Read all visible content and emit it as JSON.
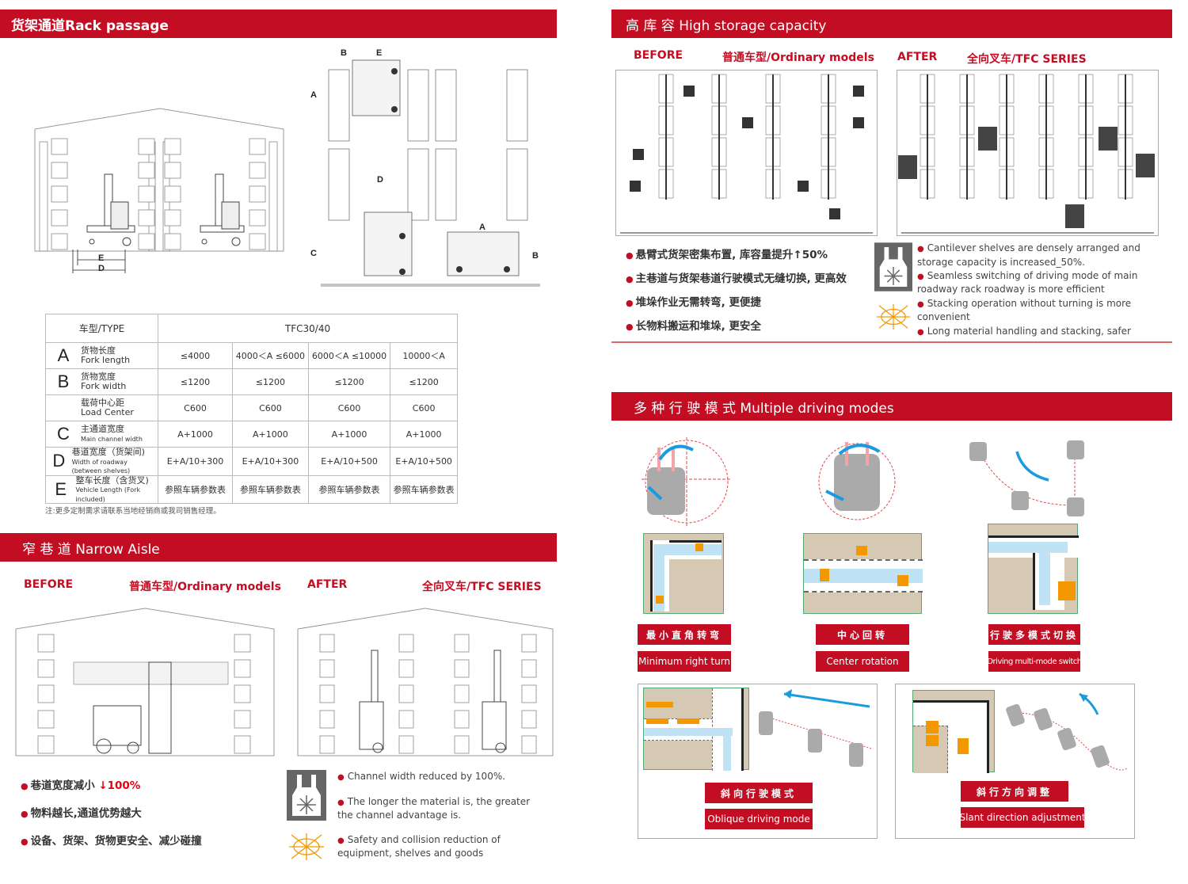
{
  "sections": {
    "rack_passage": {
      "title": "货架通道Rack passage"
    },
    "narrow_aisle": {
      "title": "窄 巷 道 Narrow Aisle"
    },
    "high_storage": {
      "title": "高 库 容 High storage capacity"
    },
    "driving_modes": {
      "title": "多 种 行 驶 模 式  Multiple driving modes"
    }
  },
  "diagram_labels": {
    "side_view": [
      "E",
      "D"
    ],
    "top_view": [
      "B",
      "E",
      "A",
      "D",
      "C",
      "A",
      "B"
    ]
  },
  "spec_table": {
    "type_label": "车型/TYPE",
    "model": "TFC30/40",
    "rows": [
      {
        "letter": "A",
        "cn": "货物长度",
        "en": "Fork length",
        "values": [
          "≤4000",
          "4000＜A ≤6000",
          "6000＜A ≤10000",
          "10000＜A"
        ]
      },
      {
        "letter": "B",
        "cn": "货物宽度",
        "en": "Fork width",
        "values": [
          "≤1200",
          "≤1200",
          "≤1200",
          "≤1200"
        ]
      },
      {
        "letter": "",
        "cn": "载荷中心距",
        "en": "Load Center",
        "values": [
          "C600",
          "C600",
          "C600",
          "C600"
        ]
      },
      {
        "letter": "C",
        "cn": "主通道宽度",
        "en": "Main channel width",
        "values": [
          "A+1000",
          "A+1000",
          "A+1000",
          "A+1000"
        ]
      },
      {
        "letter": "D",
        "cn": "巷道宽度（货架间)",
        "en": "Width of roadway (between shelves)",
        "values": [
          "E+A/10+300",
          "E+A/10+300",
          "E+A/10+500",
          "E+A/10+500"
        ]
      },
      {
        "letter": "E",
        "cn": "整车长度（含货叉)",
        "en": "Vehicle Length (Fork included)",
        "values": [
          "参照车辆参数表",
          "参照车辆参数表",
          "参照车辆参数表",
          "参照车辆参数表"
        ]
      }
    ],
    "note": "注:更多定制需求请联系当地经销商或我司销售经理。"
  },
  "narrow_aisle": {
    "before": "BEFORE",
    "before_model": "普通车型/Ordinary models",
    "after": "AFTER",
    "after_model": "全向叉车/TFC SERIES",
    "cn_bullets": [
      "巷道宽度减小",
      "物料越长,通道优势越大",
      "设备、货架、货物更安全、减少碰撞"
    ],
    "highlight": "↓100%",
    "en_bullets": [
      "Channel width reduced by 100%.",
      "The longer the material is, the greater the channel advantage is.",
      "Safety and collision reduction of equipment, shelves and goods"
    ]
  },
  "high_storage": {
    "before": "BEFORE",
    "before_model": "普通车型/Ordinary models",
    "after": "AFTER",
    "after_model": "全向叉车/TFC SERIES",
    "cn_bullets": [
      "悬臂式货架密集布置, 库容量提升↑50%",
      "主巷道与货架巷道行驶模式无缝切换, 更高效",
      "堆垛作业无需转弯, 更便捷",
      "长物料搬运和堆垛, 更安全"
    ],
    "en_bullets": [
      "Cantilever shelves are densely arranged and storage capacity is increased_50%.",
      "Seamless switching of driving mode of main roadway rack roadway is more efficient",
      "Stacking operation without turning is more convenient",
      "Long material handling and stacking, safer"
    ]
  },
  "driving_modes": {
    "modes": [
      {
        "cn": "最小直角转弯",
        "en": "Minimum right turn"
      },
      {
        "cn": "中心回转",
        "en": "Center rotation"
      },
      {
        "cn": "行驶多模式切换",
        "en": "Driving multi-mode switch"
      },
      {
        "cn": "斜向行驶模式",
        "en": "Oblique driving mode"
      },
      {
        "cn": "斜行方向调整",
        "en": "Slant direction adjustment"
      }
    ]
  },
  "colors": {
    "brand_red": "#c30d23",
    "accent_blue": "#1a9be0",
    "cargo_orange": "#f39800",
    "floor_tan": "#d5c9b3"
  }
}
